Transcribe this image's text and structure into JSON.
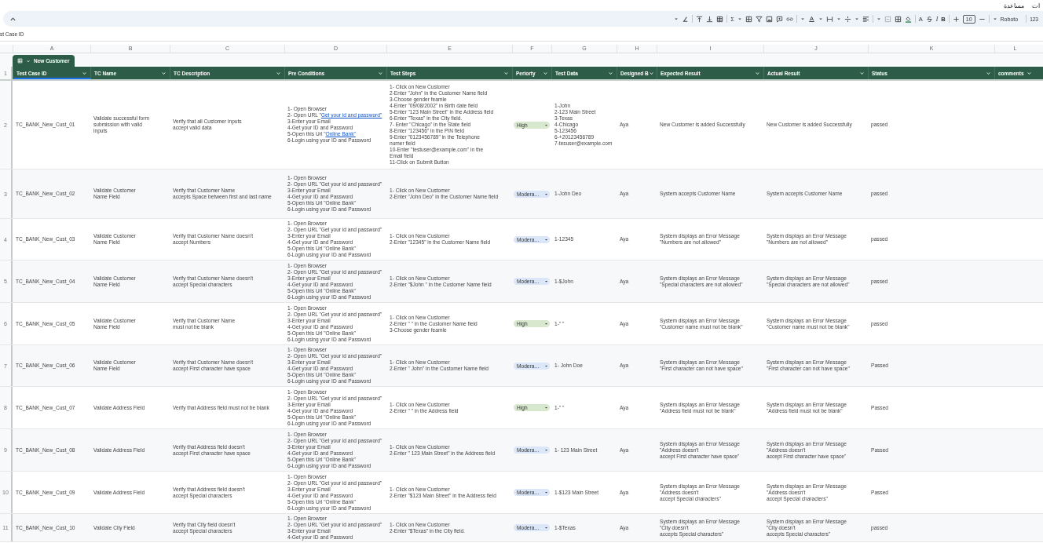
{
  "top_menu": [
    "ات",
    "مساعدة"
  ],
  "toolbar": {
    "sum": "Σ",
    "text_color": "A",
    "italic": "I",
    "bold": "B",
    "font_size": "10",
    "font": "Roboto",
    "number_format": "123"
  },
  "formula_bar": {
    "value": "st Case ID"
  },
  "column_letters": [
    "A",
    "B",
    "C",
    "D",
    "E",
    "F",
    "G",
    "H",
    "I",
    "J",
    "K",
    "L"
  ],
  "table": {
    "name": "New Customer",
    "columns": [
      {
        "label": "Test Case ID",
        "selected": true
      },
      {
        "label": "TC Name",
        "selected": false
      },
      {
        "label": "TC Description",
        "selected": false
      },
      {
        "label": "Pre Conditions",
        "selected": false
      },
      {
        "label": "Test Steps",
        "selected": false
      },
      {
        "label": "Periorty",
        "selected": false
      },
      {
        "label": "Test Data",
        "selected": false
      },
      {
        "label": "Designed B",
        "selected": false
      },
      {
        "label": "Expected Result",
        "selected": false
      },
      {
        "label": "Actual Result",
        "selected": false
      },
      {
        "label": "Status",
        "selected": false
      },
      {
        "label": "comments",
        "selected": false
      }
    ],
    "header_row_number": "1",
    "rows": [
      {
        "number": "2",
        "id": "TC_BANK_New_Cust_01",
        "name": "Validate successful form\nsubmission with valid\n inputs",
        "description": "Verify that all Customer inputs\naccept valid data",
        "preconditions": [
          "1- Open Browser",
          {
            "before": "2- Open URL \"",
            "link": "Get your id and password\""
          },
          "3-Enter your Email",
          "4-Get your ID and Password",
          {
            "before": "5-Open this Url \"",
            "link": "Online Bank\""
          },
          "6-Login using your ID and Password"
        ],
        "steps": [
          "1- Click on New Customer",
          "2-Enter \"John\" in the Customer Name field",
          "3-Choose gender feamle",
          "4-Enter \"09/08/2002\" in Birth date field",
          "5-Enter \"123 Main Street\" in the Address field",
          "6-Enter \"Texas\" in the City field.",
          "7- Enter \"Chicago\" in the State field",
          "8-Enter \"123456\" in the PIN field",
          "9-Enter \"0123456789\" in the Telephone\n numer field",
          "10-Enter \"testuser@example.com\" in the\nEmail field",
          "11-Click on Submit Button"
        ],
        "priority": {
          "label": "High",
          "kind": "high"
        },
        "test_data": "1-John\n2-123 Main Street\n3-Texas\n4-Chicago\n5-123456\n6-+20123456789\n7-tesuser@example.com",
        "designed_by": "Aya",
        "expected": "New Customer is added Successfully",
        "actual": "New Customer is added Successfully",
        "status": "passed"
      },
      {
        "number": "3",
        "id": "TC_BANK_New_Cust_02",
        "name": "Validate Customer\nName Field",
        "description": "Verify that Customer Name\naccepts Space between first and last name",
        "preconditions": [
          "1- Open Browser",
          "2- Open URL \"Get your id and password\"",
          "3-Enter your Email",
          "4-Get your ID and Password",
          "5-Open this Url \"Online Bank\"",
          "6-Login using your ID and Password"
        ],
        "steps": [
          "1- Click on New Customer",
          "2-Enter \"John Deo\" in the Customer Name field"
        ],
        "priority": {
          "label": "Modera…",
          "kind": "moderate"
        },
        "test_data": "1-John Deo",
        "designed_by": "Aya",
        "expected": "System accepts Customer Name",
        "actual": "System accepts Customer Name",
        "status": "passed"
      },
      {
        "number": "4",
        "id": "TC_BANK_New_Cust_03",
        "name": "Validate Customer\nName Field",
        "description": "Verify that Customer Name doesn't\naccept Numbers",
        "preconditions": [
          "1- Open Browser",
          "2- Open URL \"Get your id and password\"",
          "3-Enter your Email",
          "4-Get your ID and Password",
          "5-Open this Url \"Online Bank\"",
          "6-Login using your ID and Password"
        ],
        "steps": [
          "1- Click on New Customer",
          "2-Enter \"12345\" in the Customer Name field"
        ],
        "priority": {
          "label": "Modera…",
          "kind": "moderate"
        },
        "test_data": "1-12345",
        "designed_by": "Aya",
        "expected": "System displays an Error Message\n\"Numbers are not allowed\"",
        "actual": "System displays an Error Message\n\"Numbers are not allowed\"",
        "status": "passed"
      },
      {
        "number": "5",
        "id": "TC_BANK_New_Cust_04",
        "name": "Validate Customer\nName Field",
        "description": "Verify that Customer Name doesn't\naccept Special characters",
        "preconditions": [
          "1- Open Browser",
          "2- Open URL \"Get your id and password\"",
          "3-Enter your Email",
          "4-Get your ID and Password",
          "5-Open this Url \"Online Bank\"",
          "6-Login using your ID and Password"
        ],
        "steps": [
          "1- Click on New Customer",
          "2-Enter \"$John \" in the Customer Name field"
        ],
        "priority": {
          "label": "Modera…",
          "kind": "moderate"
        },
        "test_data": "1-$John",
        "designed_by": "Aya",
        "expected": "System displays an Error Message\n\"Special characters are not allowed\"",
        "actual": "System displays an Error Message\n\"Special characters are not allowed\"",
        "status": "passed"
      },
      {
        "number": "6",
        "id": "TC_BANK_New_Cust_05",
        "name": "Validate Customer\nName Field",
        "description": "Verify that Customer Name\nmust not be blank",
        "preconditions": [
          "1- Open Browser",
          "2- Open URL \"Get your id and password\"",
          "3-Enter your Email",
          "4-Get your ID and Password",
          "5-Open this Url \"Online Bank\"",
          "6-Login using your ID and Password"
        ],
        "steps": [
          "1- Click on New Customer",
          "2-Enter \" \" in the Customer Name field",
          "3-Choose gender feamle"
        ],
        "priority": {
          "label": "High",
          "kind": "high"
        },
        "test_data": "1-\" \"",
        "designed_by": "Aya",
        "expected": "System displays an Error Message\n\"Customer name must not be blank\"",
        "actual": "System displays an Error Message\n\"Customer name must not be blank\"",
        "status": "passed"
      },
      {
        "number": "7",
        "id": "TC_BANK_New_Cust_06",
        "name": "Validate Customer\nName Field",
        "description": "Verify that Customer Name doesn't\naccept First character have space",
        "preconditions": [
          "1- Open Browser",
          "2- Open URL \"Get your id and password\"",
          "3-Enter your Email",
          "4-Get your ID and Password",
          "5-Open this Url \"Online Bank\"",
          "6-Login using your ID and Password"
        ],
        "steps": [
          "1- Click on New Customer",
          "2-Enter \"  John\" in the Customer Name field"
        ],
        "priority": {
          "label": "Modera…",
          "kind": "moderate"
        },
        "test_data": "1-  John Doe",
        "designed_by": "Aya",
        "expected": "System displays an Error Message\n\"First character can not have space\"",
        "actual": "System displays an Error Message\n\"First character can not have space\"",
        "status": "Passed"
      },
      {
        "number": "8",
        "id": "TC_BANK_New_Cust_07",
        "name": "Validate Address Field",
        "description": "Verify that Address field must not be blank",
        "preconditions": [
          "1- Open Browser",
          "2- Open URL \"Get your id and password\"",
          "3-Enter your Email",
          "4-Get your ID and Password",
          "5-Open this Url \"Online Bank\"",
          "6-Login using your ID and Password"
        ],
        "steps": [
          "1- Click on New Customer",
          "2-Enter \" \" in the Address field"
        ],
        "priority": {
          "label": "High",
          "kind": "high"
        },
        "test_data": "1-\" \"",
        "designed_by": "Aya",
        "expected": "System displays an Error Message\n\"Address field must not be blank\"",
        "actual": "System displays an Error Message\n\"Address field must not be blank\"",
        "status": "Passed"
      },
      {
        "number": "9",
        "id": "TC_BANK_New_Cust_08",
        "name": "Validate Address Field",
        "description": "Verify that Address field doesn't\naccept First character have space",
        "preconditions": [
          "1- Open Browser",
          "2- Open URL \"Get your id and password\"",
          "3-Enter your Email",
          "4-Get your ID and Password",
          "5-Open this Url \"Online Bank\"",
          "6-Login using your ID and Password"
        ],
        "steps": [
          "1- Click on New Customer",
          "2-Enter \"  123 Main Street\" in the Address field"
        ],
        "priority": {
          "label": "Modera…",
          "kind": "moderate"
        },
        "test_data": "1-  123 Main Street",
        "designed_by": "Aya",
        "expected": "System displays an Error Message\n\"Address doesn't\naccept First character have space\"",
        "actual": "System displays an Error Message\n\"Address doesn't\naccept First character have space\"",
        "status": "Passed"
      },
      {
        "number": "10",
        "id": "TC_BANK_New_Cust_09",
        "name": "Validate Address Field",
        "description": "Verify that Address field doesn't\naccept Special characters",
        "preconditions": [
          "1- Open Browser",
          "2- Open URL \"Get your id and password\"",
          "3-Enter your Email",
          "4-Get your ID and Password",
          "5-Open this Url \"Online Bank\"",
          "6-Login using your ID and Password"
        ],
        "steps": [
          "1- Click on New Customer",
          "2-Enter \"$123 Main Street\" in the Address field"
        ],
        "priority": {
          "label": "Modera…",
          "kind": "moderate"
        },
        "test_data": "1-$123 Main Street",
        "designed_by": "Aya",
        "expected": "System displays an Error Message\n\"Address doesn't\naccept Special characters\"",
        "actual": "System displays an Error Message\n\"Address doesn't\naccept Special characters\"",
        "status": "Passed"
      },
      {
        "number": "11",
        "id": "TC_BANK_New_Cust_10",
        "name": "Validate City Field",
        "description": "Verify that City field doesn't\naccept Special characters",
        "preconditions": [
          "1- Open Browser",
          "2- Open URL \"Get your id and password\"",
          "3-Enter your Email",
          "4-Get your ID and Password"
        ],
        "steps": [
          "1- Click on New Customer",
          "2-Enter \"$Texas\" in the City field."
        ],
        "priority": {
          "label": "Modera…",
          "kind": "moderate"
        },
        "test_data": "1-$Texas",
        "designed_by": "Aya",
        "expected": "System displays an Error Message\n\"City doesn't\naccepts Special characters\"",
        "actual": "System displays an Error Message\n\"City doesn't\naccepts Special characters\"",
        "status": "passed"
      }
    ]
  }
}
